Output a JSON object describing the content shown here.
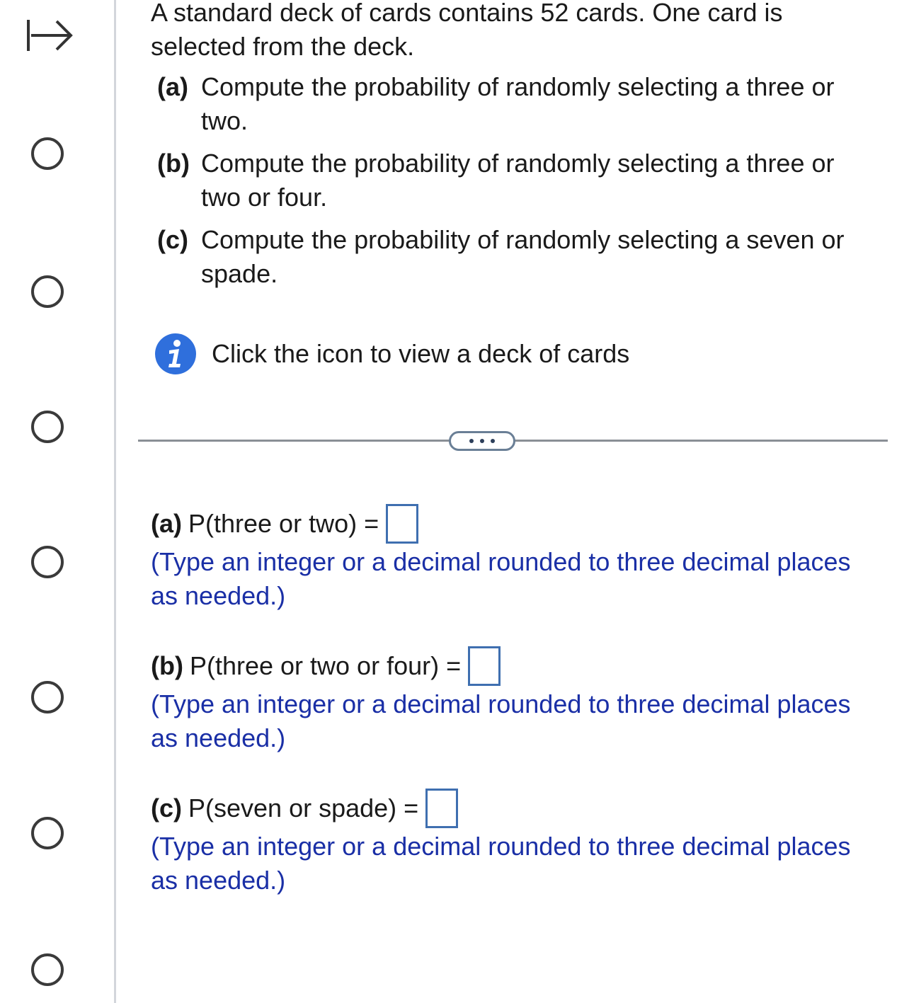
{
  "question": {
    "intro": "A standard deck of cards contains 52 cards. One card is selected from the deck.",
    "parts": [
      {
        "label": "(a)",
        "text": "Compute the probability of randomly selecting a three or two."
      },
      {
        "label": "(b)",
        "text": "Compute the probability of randomly selecting a three or two or four."
      },
      {
        "label": "(c)",
        "text": "Compute the probability of randomly selecting a seven or spade."
      }
    ],
    "info_text": "Click the icon to view a deck of cards"
  },
  "answers": [
    {
      "label": "(a)",
      "expression": "P(three or two) =",
      "value": "",
      "hint": "(Type an integer or a decimal rounded to three decimal places as needed.)"
    },
    {
      "label": "(b)",
      "expression": "P(three or two or four) =",
      "value": "",
      "hint": "(Type an integer or a decimal rounded to three decimal places as needed.)"
    },
    {
      "label": "(c)",
      "expression": "P(seven or spade) =",
      "value": "",
      "hint": "(Type an integer or a decimal rounded to three decimal places as needed.)"
    }
  ],
  "icons": {
    "expand": "expand-right-icon",
    "info": "info-icon",
    "more": "more-options-icon"
  },
  "colors": {
    "hint_text": "#1a2fa6",
    "info_icon": "#2f6fdc",
    "answer_box_border": "#3f6fb0"
  }
}
